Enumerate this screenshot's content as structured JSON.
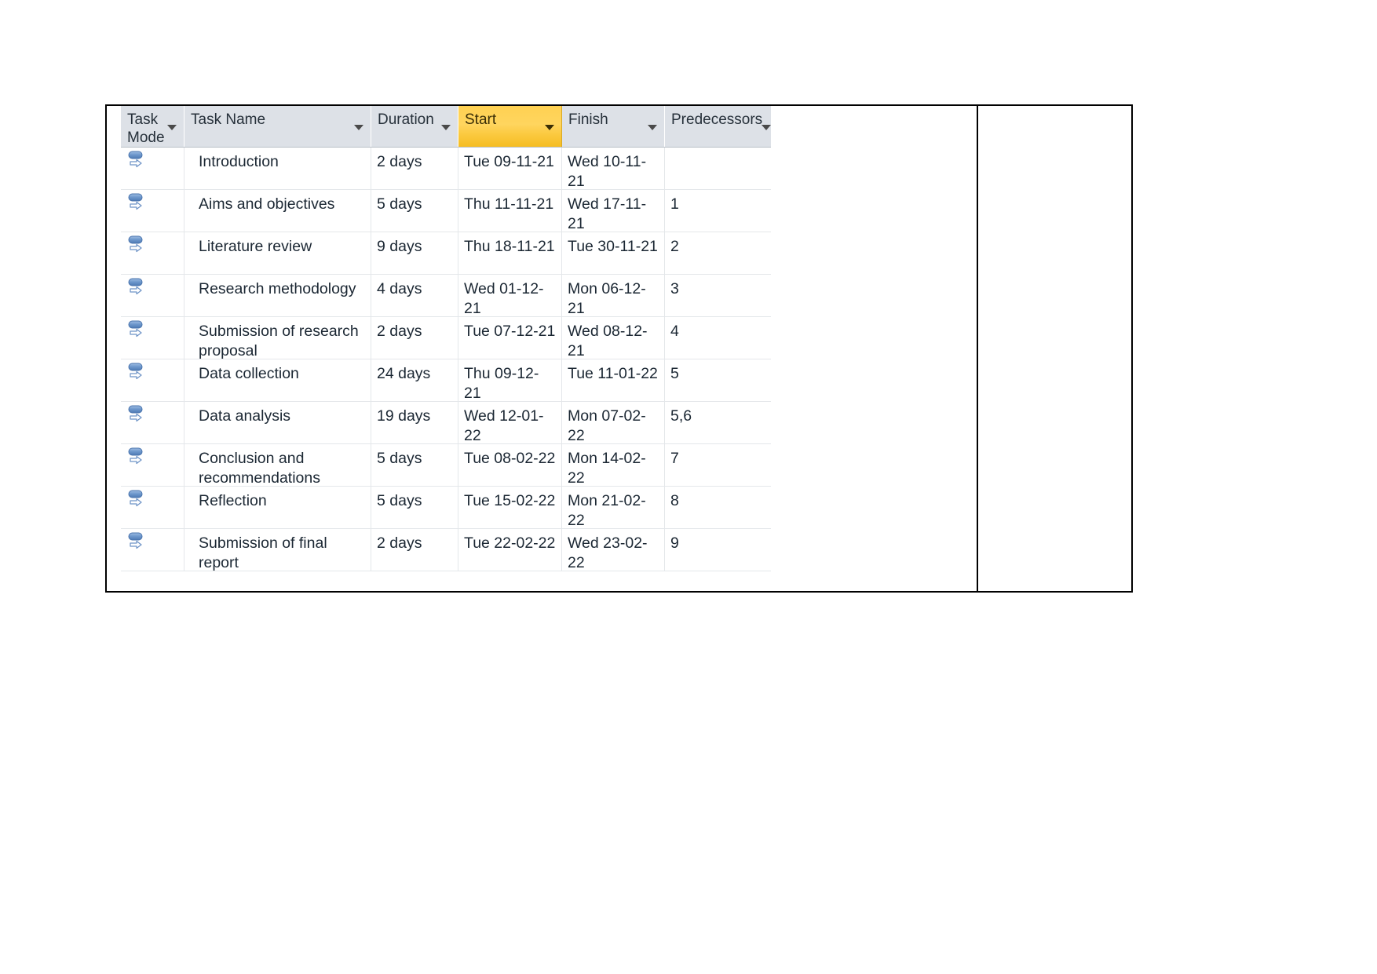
{
  "document": {
    "page_background": "#ffffff",
    "outer_border_color": "#000000"
  },
  "project_grid": {
    "header_background": "#dde1e7",
    "highlight_color": "#f5bd22",
    "text_color": "#1b2733",
    "gridline_color": "#e4e7ea",
    "columns": [
      {
        "key": "task_mode",
        "label": "Task\nMode",
        "highlighted": false,
        "has_filter": true
      },
      {
        "key": "task_name",
        "label": "Task Name",
        "highlighted": false,
        "has_filter": true
      },
      {
        "key": "duration",
        "label": "Duration",
        "highlighted": false,
        "has_filter": true
      },
      {
        "key": "start",
        "label": "Start",
        "highlighted": true,
        "has_filter": true
      },
      {
        "key": "finish",
        "label": "Finish",
        "highlighted": false,
        "has_filter": true
      },
      {
        "key": "predecessors",
        "label": "Predecessors",
        "highlighted": false,
        "has_filter": true
      }
    ],
    "rows": [
      {
        "mode_icon": "auto-scheduled-icon",
        "task_name": "Introduction",
        "duration": "2 days",
        "start": "Tue 09-11-21",
        "finish": "Wed 10-11-21",
        "predecessors": ""
      },
      {
        "mode_icon": "auto-scheduled-icon",
        "task_name": "Aims and objectives",
        "duration": "5 days",
        "start": "Thu 11-11-21",
        "finish": "Wed 17-11-21",
        "predecessors": "1"
      },
      {
        "mode_icon": "auto-scheduled-icon",
        "task_name": "Literature review",
        "duration": "9 days",
        "start": "Thu 18-11-21",
        "finish": "Tue 30-11-21",
        "predecessors": "2"
      },
      {
        "mode_icon": "auto-scheduled-icon",
        "task_name": "Research methodology",
        "duration": "4 days",
        "start": "Wed 01-12-21",
        "finish": "Mon 06-12-21",
        "predecessors": "3"
      },
      {
        "mode_icon": "auto-scheduled-icon",
        "task_name": "Submission of research proposal",
        "duration": "2 days",
        "start": "Tue 07-12-21",
        "finish": "Wed 08-12-21",
        "predecessors": "4"
      },
      {
        "mode_icon": "auto-scheduled-icon",
        "task_name": "Data collection",
        "duration": "24 days",
        "start": "Thu 09-12-21",
        "finish": "Tue 11-01-22",
        "predecessors": "5"
      },
      {
        "mode_icon": "auto-scheduled-icon",
        "task_name": "Data analysis",
        "duration": "19 days",
        "start": "Wed 12-01-22",
        "finish": "Mon 07-02-22",
        "predecessors": "5,6"
      },
      {
        "mode_icon": "auto-scheduled-icon",
        "task_name": "Conclusion and recommendations",
        "duration": "5 days",
        "start": "Tue 08-02-22",
        "finish": "Mon 14-02-22",
        "predecessors": "7"
      },
      {
        "mode_icon": "auto-scheduled-icon",
        "task_name": "Reflection",
        "duration": "5 days",
        "start": "Tue 15-02-22",
        "finish": "Mon 21-02-22",
        "predecessors": "8"
      },
      {
        "mode_icon": "auto-scheduled-icon",
        "task_name": "Submission of final report",
        "duration": "2 days",
        "start": "Tue 22-02-22",
        "finish": "Wed 23-02-22",
        "predecessors": "9"
      }
    ]
  }
}
